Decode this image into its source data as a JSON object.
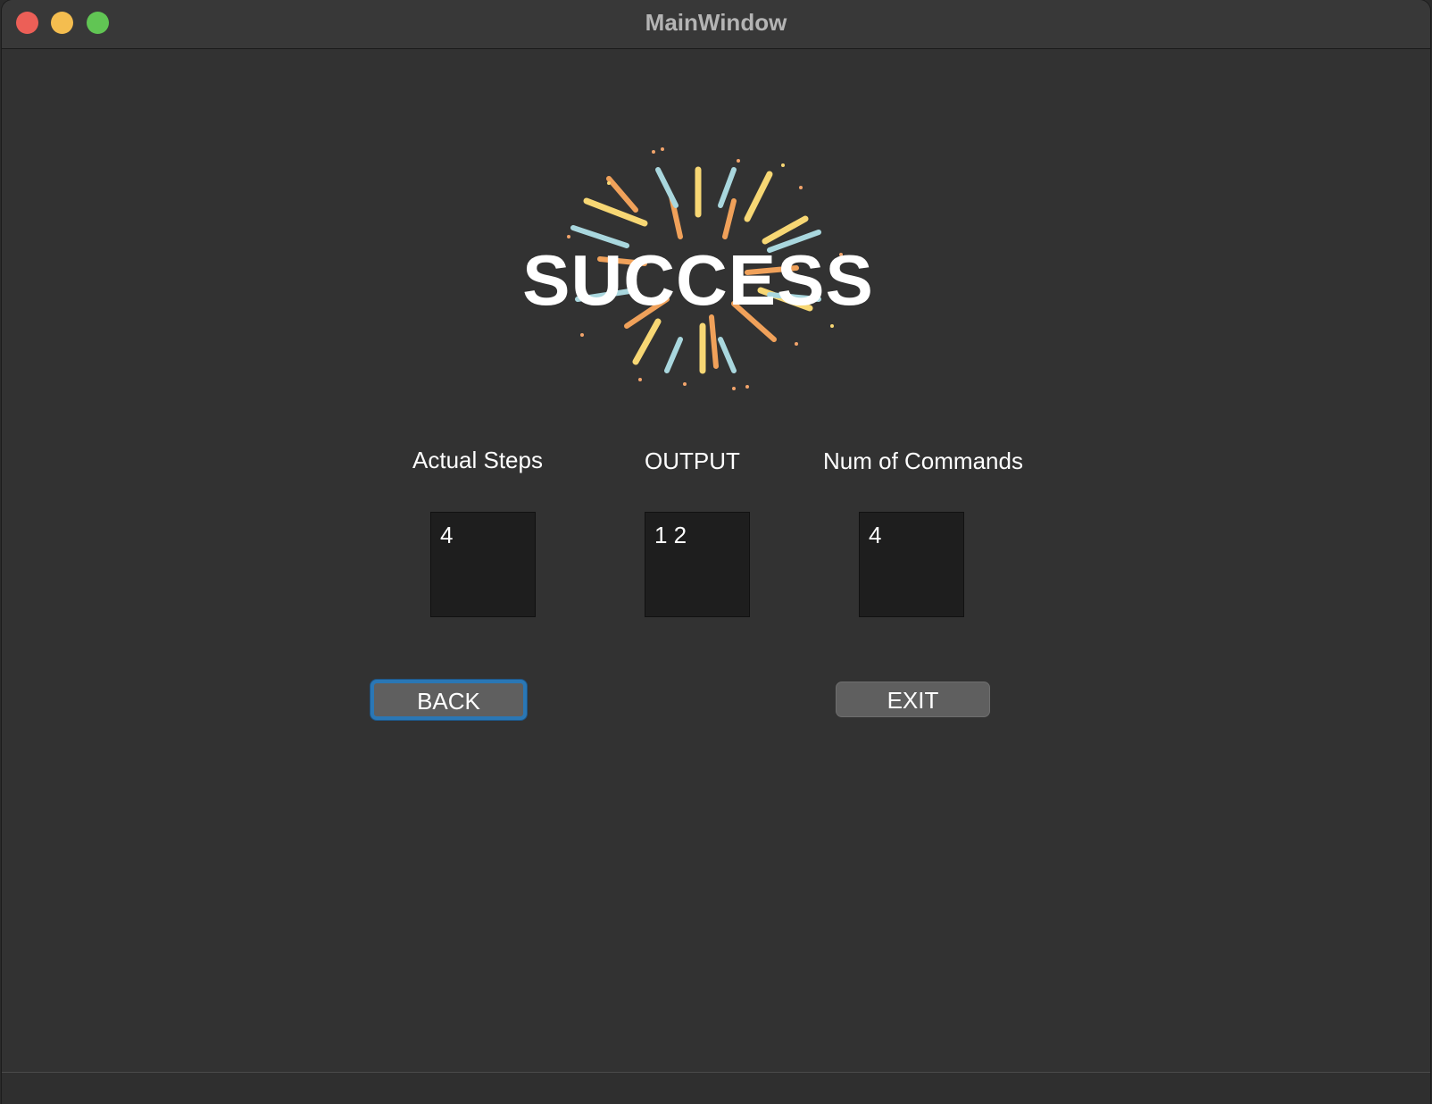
{
  "window": {
    "title": "MainWindow"
  },
  "banner": {
    "text": "SUCCESS"
  },
  "fields": {
    "actual_steps": {
      "label": "Actual Steps",
      "value": "4"
    },
    "output": {
      "label": "OUTPUT",
      "value": "1 2"
    },
    "num_commands": {
      "label": "Num of Commands",
      "value": "4"
    }
  },
  "buttons": {
    "back": "BACK",
    "exit": "EXIT"
  },
  "colors": {
    "close": "#ec5f57",
    "minimize": "#f4bd4f",
    "maximize": "#61c554",
    "focus_ring": "#2a77b5",
    "background": "#323232"
  }
}
